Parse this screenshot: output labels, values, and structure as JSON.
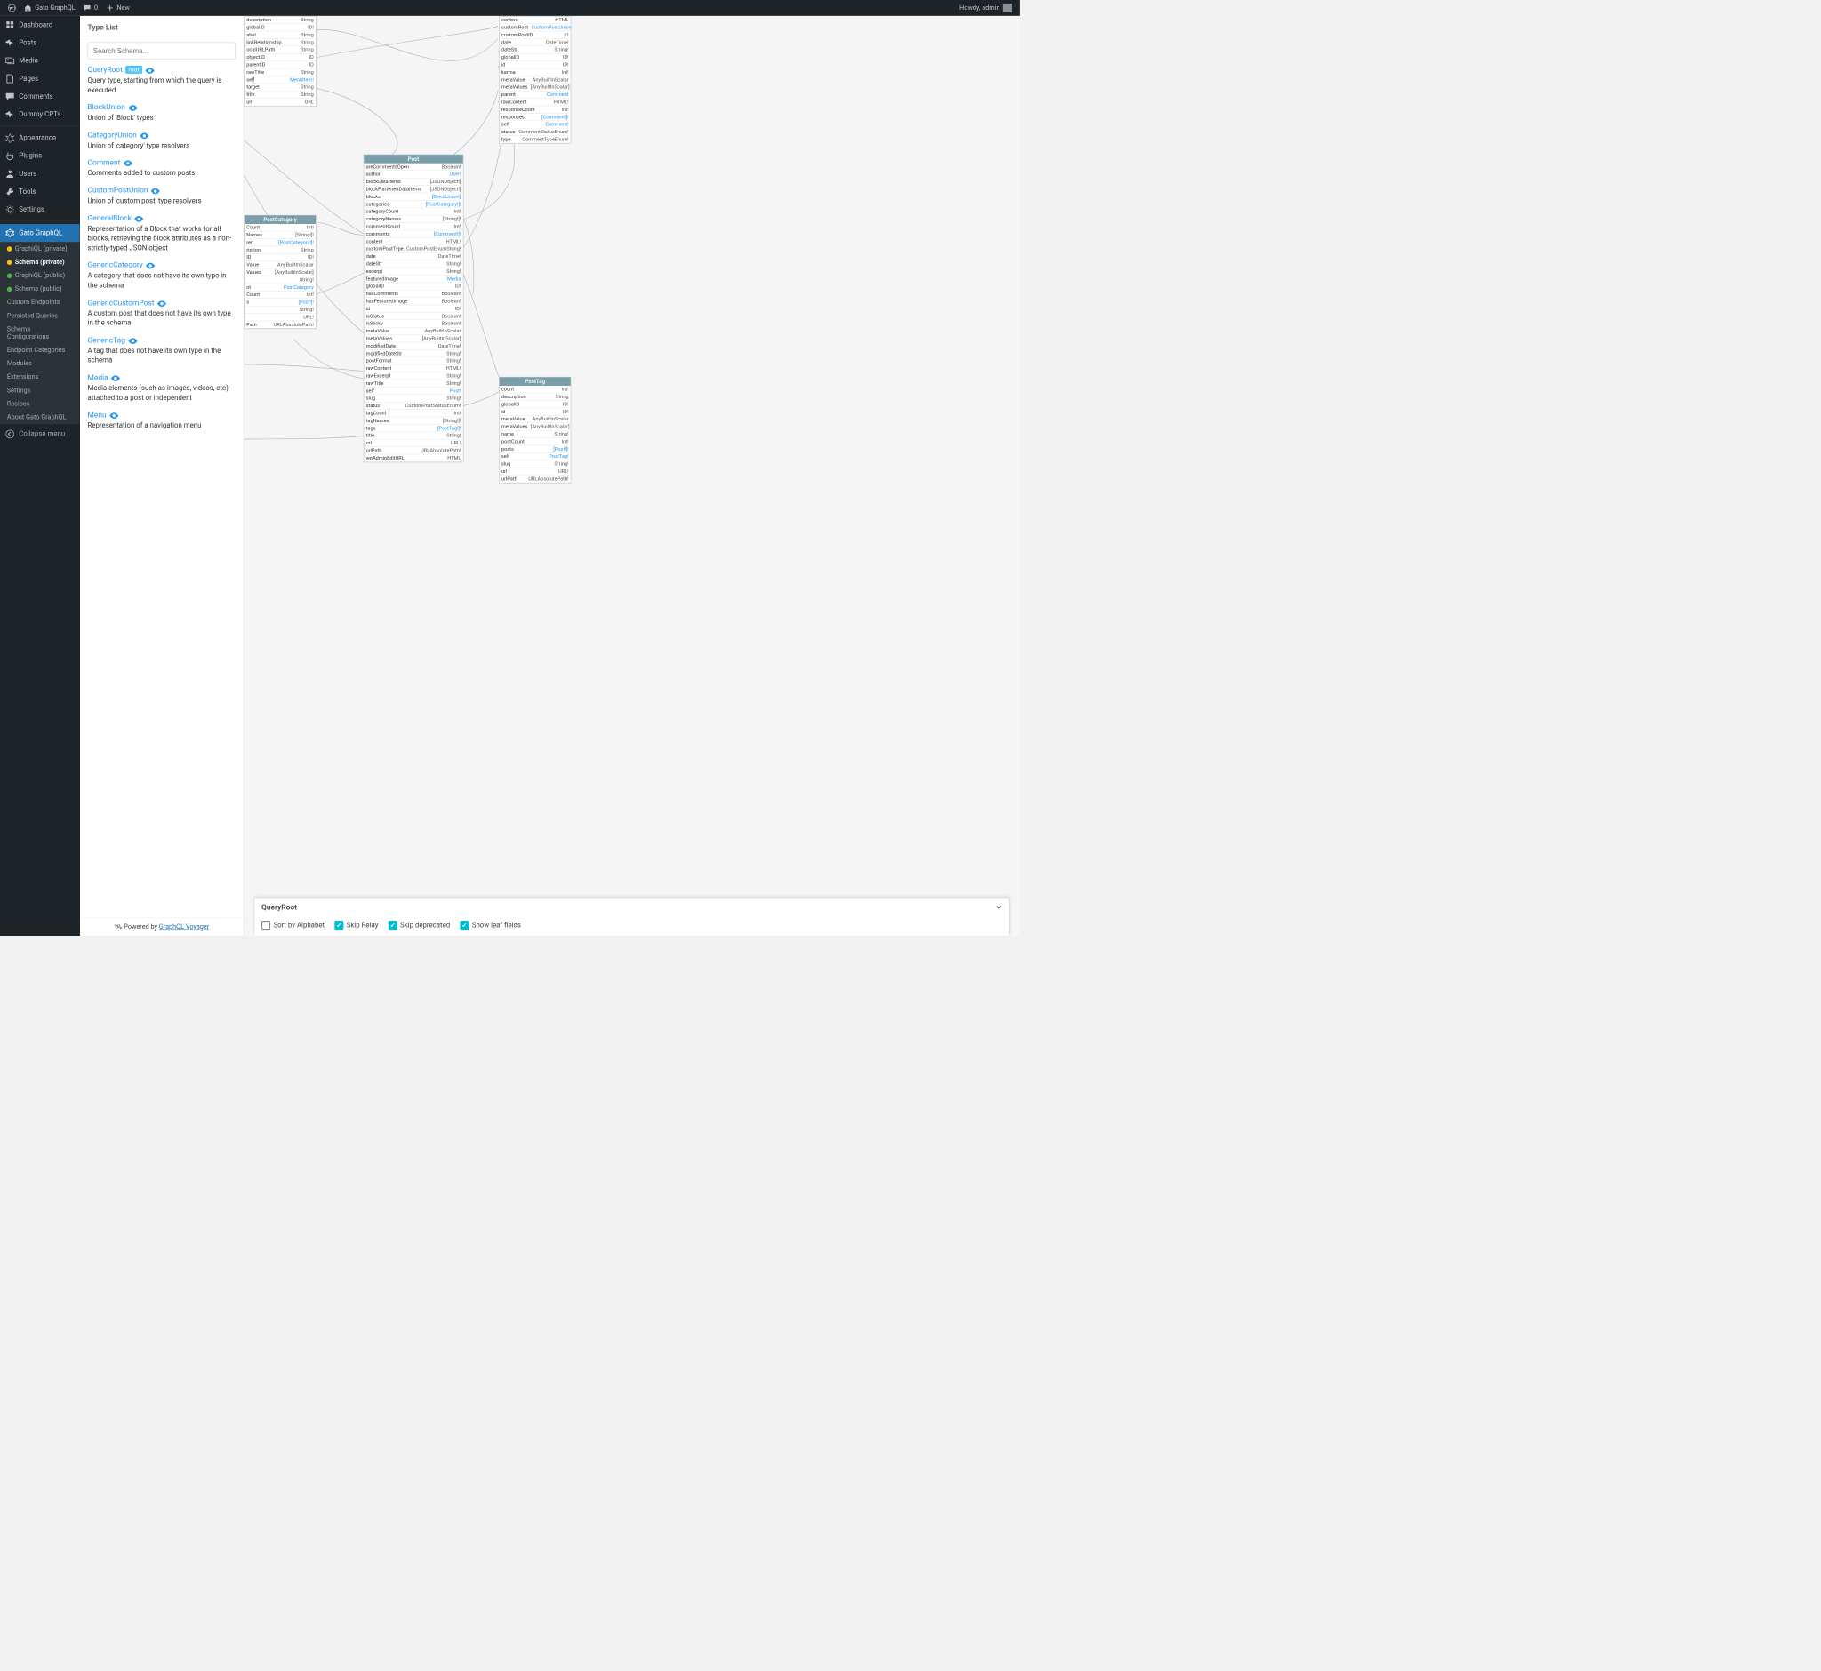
{
  "adminbar": {
    "site": "Gato GraphQL",
    "comments": "0",
    "new": "New",
    "greeting": "Howdy, admin"
  },
  "sidebar": {
    "items": [
      {
        "icon": "dashboard",
        "label": "Dashboard"
      },
      {
        "icon": "pin",
        "label": "Posts"
      },
      {
        "icon": "media",
        "label": "Media"
      },
      {
        "icon": "page",
        "label": "Pages"
      },
      {
        "icon": "comment",
        "label": "Comments"
      },
      {
        "icon": "pin",
        "label": "Dummy CPTs"
      }
    ],
    "items2": [
      {
        "icon": "appearance",
        "label": "Appearance"
      },
      {
        "icon": "plugin",
        "label": "Plugins"
      },
      {
        "icon": "user",
        "label": "Users"
      },
      {
        "icon": "tool",
        "label": "Tools"
      },
      {
        "icon": "settings",
        "label": "Settings"
      }
    ],
    "plugin_label": "Gato GraphQL",
    "submenu": [
      {
        "dot": "yellow",
        "label": "GraphiQL (private)"
      },
      {
        "dot": "yellow",
        "label": "Schema (private)",
        "current": true
      },
      {
        "dot": "green",
        "label": "GraphiQL (public)"
      },
      {
        "dot": "green",
        "label": "Schema (public)"
      },
      {
        "label": "Custom Endpoints"
      },
      {
        "label": "Persisted Queries"
      },
      {
        "label": "Schema Configurations"
      },
      {
        "label": "Endpoint Categories"
      },
      {
        "label": "Modules"
      },
      {
        "label": "Extensions"
      },
      {
        "label": "Settings"
      },
      {
        "label": "Recipes"
      },
      {
        "label": "About Gato GraphQL"
      }
    ],
    "collapse": "Collapse menu"
  },
  "doc": {
    "title": "Type List",
    "search_placeholder": "Search Schema...",
    "types": [
      {
        "name": "QueryRoot",
        "root": true,
        "desc": "Query type, starting from which the query is executed"
      },
      {
        "name": "BlockUnion",
        "desc": "Union of 'Block' types"
      },
      {
        "name": "CategoryUnion",
        "desc": "Union of 'category' type resolvers"
      },
      {
        "name": "Comment",
        "desc": "Comments added to custom posts"
      },
      {
        "name": "CustomPostUnion",
        "desc": "Union of 'custom post' type resolvers"
      },
      {
        "name": "GeneralBlock",
        "desc": "Representation of a Block that works for all blocks, retrieving the block attributes as a non-strictly-typed JSON object"
      },
      {
        "name": "GenericCategory",
        "desc": "A category that does not have its own type in the schema"
      },
      {
        "name": "GenericCustomPost",
        "desc": "A custom post that does not have its own type in the schema"
      },
      {
        "name": "GenericTag",
        "desc": "A tag that does not have its own type in the schema"
      },
      {
        "name": "Media",
        "desc": "Media elements (such as images, videos, etc), attached to a post or independent"
      },
      {
        "name": "Menu",
        "desc": "Representation of a navigation menu"
      }
    ],
    "root_badge": "root",
    "powered_prefix": "Powered by ",
    "powered_link": "GraphQL Voyager"
  },
  "bottom": {
    "title": "QueryRoot",
    "sort": "Sort by Alphabet",
    "relay": "Skip Relay",
    "deprecated": "Skip deprecated",
    "leaf": "Show leaf fields"
  },
  "nodes": {
    "n1": {
      "title": "",
      "rows": [
        [
          "description",
          "String"
        ],
        [
          "globalID",
          "ID!"
        ],
        [
          "abel",
          "String"
        ],
        [
          "linkRelationship",
          "String"
        ],
        [
          "ocalURLPath",
          "String"
        ],
        [
          "objectID",
          "ID"
        ],
        [
          "parentID",
          "ID"
        ],
        [
          "rawTitle",
          "String"
        ],
        [
          "self",
          "MenuItem!",
          true
        ],
        [
          "target",
          "String"
        ],
        [
          "title",
          "String"
        ],
        [
          "url",
          "URL"
        ]
      ]
    },
    "n2": {
      "title": "PostCategory",
      "rows": [
        [
          "Count",
          "Int!"
        ],
        [
          "Names",
          "[String!]!"
        ],
        [
          "ren",
          "[PostCategory!]!",
          true
        ],
        [
          "ription",
          "String"
        ],
        [
          "ID",
          "ID!"
        ],
        [
          "Value",
          "AnyBuiltInScalar"
        ],
        [
          "Values",
          "[AnyBuiltInScalar]"
        ],
        [
          "",
          "String!"
        ],
        [
          "nt",
          "PostCategory",
          true
        ],
        [
          "Count",
          "Int!"
        ],
        [
          "s",
          "[Post!]!",
          true
        ],
        [
          "",
          "String!"
        ],
        [
          "",
          "URL!"
        ],
        [
          "Path",
          "URLAbsolutePath!"
        ]
      ]
    },
    "post": {
      "title": "Post",
      "rows": [
        [
          "areCommentsOpen",
          "Boolean!"
        ],
        [
          "author",
          "User!",
          true
        ],
        [
          "blockDataItems",
          "[JSONObject!]"
        ],
        [
          "blockFlattenedDataItems",
          "[JSONObject!]"
        ],
        [
          "blocks",
          "[BlockUnion!]",
          true
        ],
        [
          "categories",
          "[PostCategory!]!",
          true
        ],
        [
          "categoryCount",
          "Int!"
        ],
        [
          "categoryNames",
          "[String!]!"
        ],
        [
          "commentCount",
          "Int!"
        ],
        [
          "comments",
          "[Comment!]!",
          true
        ],
        [
          "content",
          "HTML!"
        ],
        [
          "customPostType",
          "CustomPostEnumString!"
        ],
        [
          "date",
          "DateTime!"
        ],
        [
          "dateStr",
          "String!"
        ],
        [
          "excerpt",
          "String!"
        ],
        [
          "featuredImage",
          "Media",
          true
        ],
        [
          "globalID",
          "ID!"
        ],
        [
          "hasComments",
          "Boolean!"
        ],
        [
          "hasFeaturedImage",
          "Boolean!"
        ],
        [
          "id",
          "ID!"
        ],
        [
          "isStatus",
          "Boolean!"
        ],
        [
          "isSticky",
          "Boolean!"
        ],
        [
          "metaValue",
          "AnyBuiltInScalar"
        ],
        [
          "metaValues",
          "[AnyBuiltInScalar]"
        ],
        [
          "modifiedDate",
          "DateTime!"
        ],
        [
          "modifiedDateStr",
          "String!"
        ],
        [
          "postFormat",
          "String!"
        ],
        [
          "rawContent",
          "HTML!"
        ],
        [
          "rawExcerpt",
          "String!"
        ],
        [
          "rawTitle",
          "String!"
        ],
        [
          "self",
          "Post!",
          true
        ],
        [
          "slug",
          "String!"
        ],
        [
          "status",
          "CustomPostStatusEnum!"
        ],
        [
          "tagCount",
          "Int!"
        ],
        [
          "tagNames",
          "[String!]!"
        ],
        [
          "tags",
          "[PostTag!]!",
          true
        ],
        [
          "title",
          "String!"
        ],
        [
          "url",
          "URL!"
        ],
        [
          "urlPath",
          "URLAbsolutePath!"
        ],
        [
          "wpAdminEditURL",
          "HTML"
        ]
      ]
    },
    "n3": {
      "title": "",
      "rows": [
        [
          "content",
          "HTML"
        ],
        [
          "customPost",
          "CustomPostUnion",
          true
        ],
        [
          "customPostID",
          "ID"
        ],
        [
          "date",
          "DateTime!"
        ],
        [
          "dateStr",
          "String!"
        ],
        [
          "globalID",
          "ID!"
        ],
        [
          "id",
          "ID!"
        ],
        [
          "karma",
          "Int!"
        ],
        [
          "metaValue",
          "AnyBuiltInScalar"
        ],
        [
          "metaValues",
          "[AnyBuiltInScalar]"
        ],
        [
          "parent",
          "Comment",
          true
        ],
        [
          "rawContent",
          "HTML!"
        ],
        [
          "responseCount",
          "Int!"
        ],
        [
          "responses",
          "[Comment!]!",
          true
        ],
        [
          "self",
          "Comment!",
          true
        ],
        [
          "status",
          "CommentStatusEnum!"
        ],
        [
          "type",
          "CommentTypeEnum!"
        ]
      ]
    },
    "posttag": {
      "title": "PostTag",
      "rows": [
        [
          "count",
          "Int!"
        ],
        [
          "description",
          "String"
        ],
        [
          "globalID",
          "ID!"
        ],
        [
          "id",
          "ID!"
        ],
        [
          "metaValue",
          "AnyBuiltInScalar"
        ],
        [
          "metaValues",
          "[AnyBuiltInScalar]"
        ],
        [
          "name",
          "String!"
        ],
        [
          "postCount",
          "Int!"
        ],
        [
          "posts",
          "[Post!]!",
          true
        ],
        [
          "self",
          "PostTag!",
          true
        ],
        [
          "slug",
          "String!"
        ],
        [
          "url",
          "URL!"
        ],
        [
          "urlPath",
          "URLAbsolutePath!"
        ]
      ]
    }
  }
}
